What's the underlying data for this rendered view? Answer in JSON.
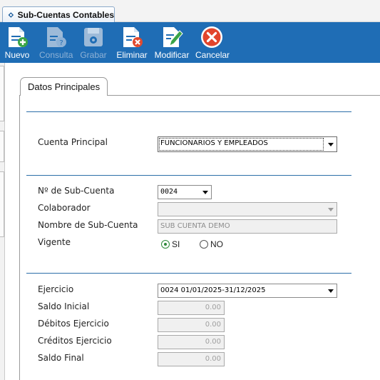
{
  "window": {
    "tab_title": "Sub-Cuentas Contables"
  },
  "toolbar": {
    "nuevo": "Nuevo",
    "consulta": "Consulta",
    "grabar": "Grabar",
    "eliminar": "Eliminar",
    "modificar": "Modificar",
    "cancelar": "Cancelar"
  },
  "colors": {
    "toolbar_bg": "#1f6db5",
    "section_rule": "#2c6fa9",
    "radio_on": "#2e8a3a"
  },
  "section": {
    "tab_label": "Datos Principales"
  },
  "form": {
    "cuenta_principal": {
      "label": "Cuenta Principal",
      "value": "FUNCIONARIOS Y EMPLEADOS"
    },
    "numero": {
      "label": "Nº de Sub-Cuenta",
      "value": "0024"
    },
    "colaborador": {
      "label": "Colaborador",
      "value": ""
    },
    "nombre": {
      "label": "Nombre de Sub-Cuenta",
      "value": "SUB CUENTA DEMO"
    },
    "vigente": {
      "label": "Vigente",
      "si": "SI",
      "no": "NO",
      "selected": "SI"
    },
    "ejercicio": {
      "label": "Ejercicio",
      "value": "0024 01/01/2025-31/12/2025"
    },
    "saldo_inicial": {
      "label": "Saldo Inicial",
      "value": "0.00"
    },
    "debitos": {
      "label": "Débitos Ejercicio",
      "value": "0.00"
    },
    "creditos": {
      "label": "Créditos Ejercicio",
      "value": "0.00"
    },
    "saldo_final": {
      "label": "Saldo Final",
      "value": "0.00"
    }
  }
}
